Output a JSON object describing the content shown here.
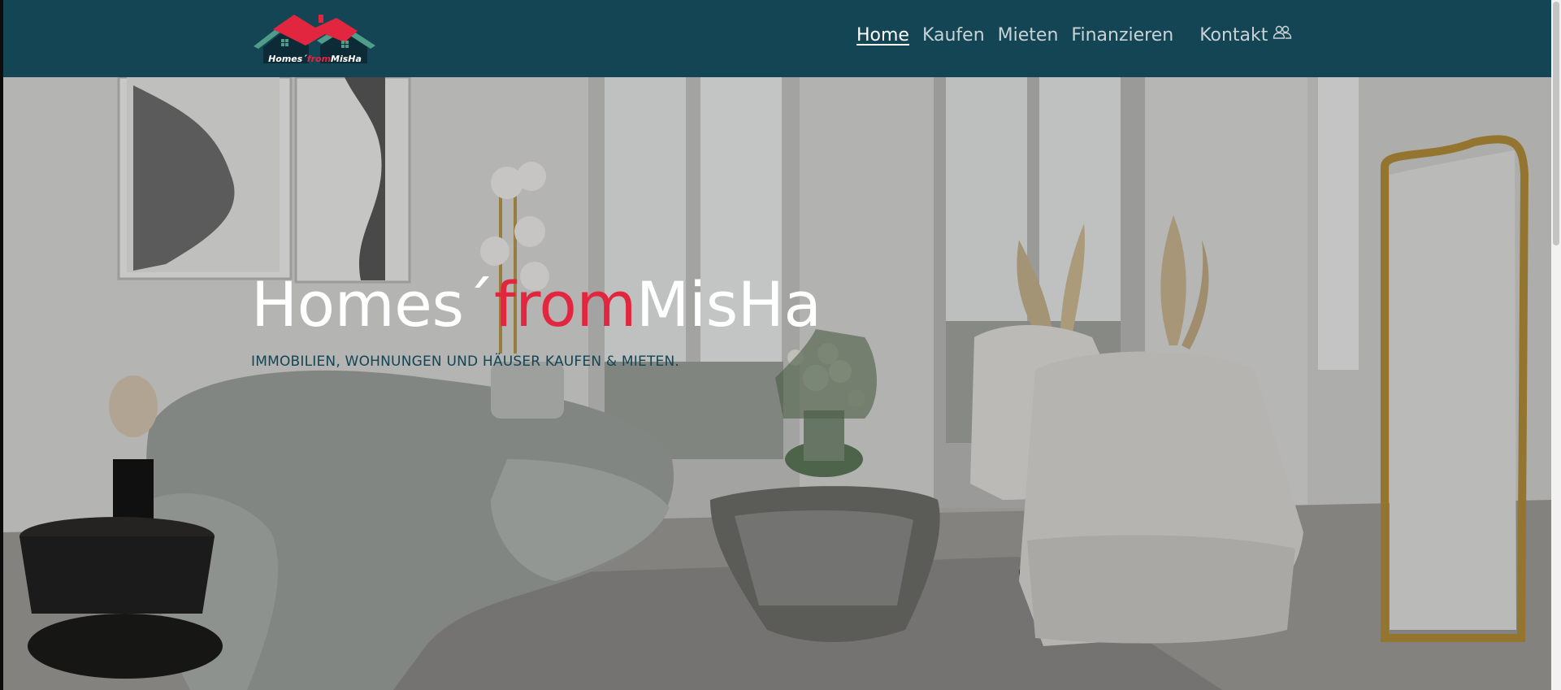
{
  "brand": {
    "logo_part1": "Homes´",
    "logo_part2": "from",
    "logo_part3": "MisHa",
    "colors": {
      "header_bg": "#134555",
      "accent_red": "#e3263f",
      "roof_green": "#4f9c89"
    }
  },
  "nav": {
    "items": [
      {
        "label": "Home",
        "active": true
      },
      {
        "label": "Kaufen",
        "active": false
      },
      {
        "label": "Mieten",
        "active": false
      },
      {
        "label": "Finanzieren",
        "active": false
      }
    ],
    "contact": {
      "label": "Kontakt",
      "icon": "users-icon"
    }
  },
  "hero": {
    "title_part1": "Homes´",
    "title_part2": "from",
    "title_part3": "MisHa",
    "subtitle": "IMMOBILIEN, WOHNUNGEN UND HÄUSER KAUFEN & MIETEN."
  }
}
